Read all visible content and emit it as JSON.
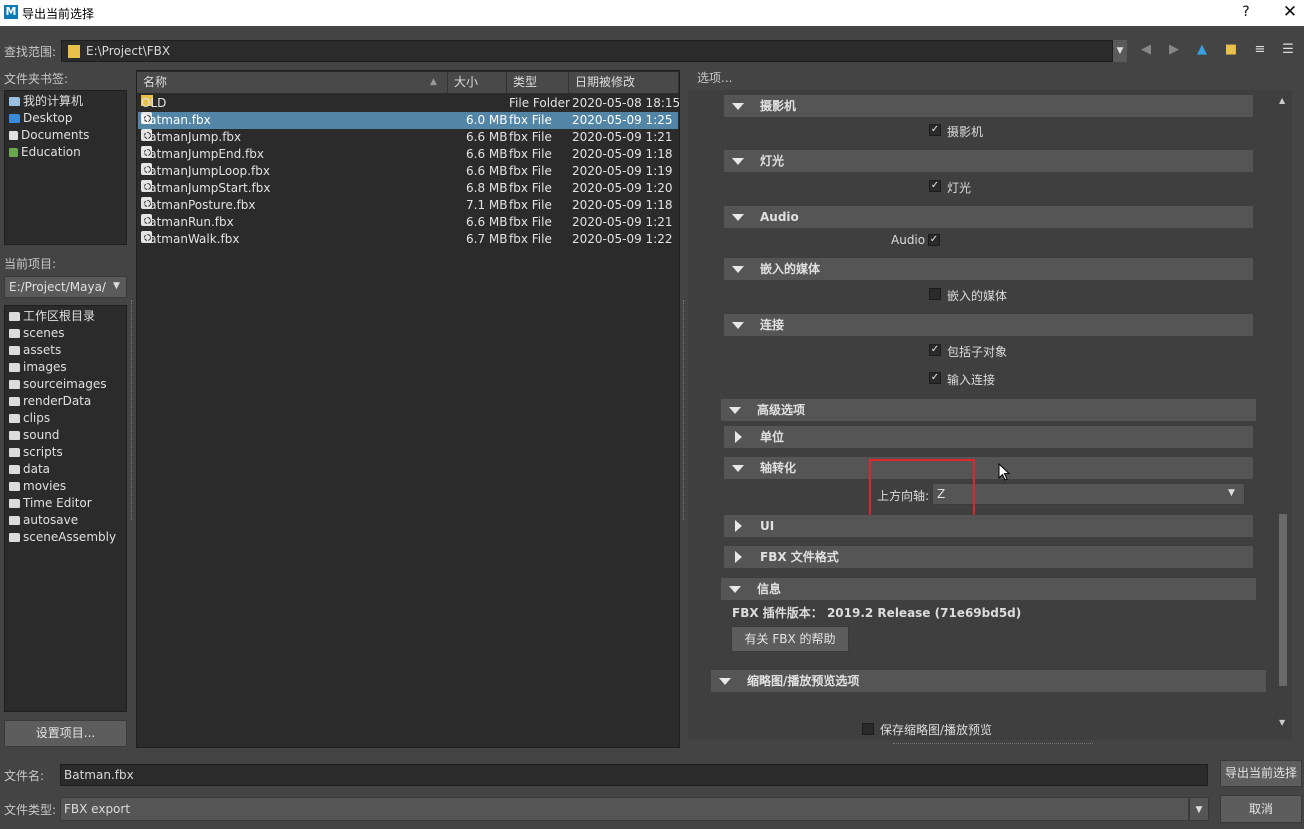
{
  "window": {
    "title": "导出当前选择",
    "help": "?",
    "close": "✕",
    "logo": "M"
  },
  "look_in": {
    "label": "查找范围:",
    "path": "E:\\Project\\FBX"
  },
  "options_title": "选项...",
  "bookmarks": {
    "label": "文件夹书签:",
    "items": [
      {
        "label": "我的计算机"
      },
      {
        "label": "Desktop"
      },
      {
        "label": "Documents"
      },
      {
        "label": "Education"
      }
    ]
  },
  "project": {
    "label": "当前项目:",
    "value": "E:/Project/Maya/",
    "items": [
      "工作区根目录",
      "scenes",
      "assets",
      "images",
      "sourceimages",
      "renderData",
      "clips",
      "sound",
      "scripts",
      "data",
      "movies",
      "Time Editor",
      "autosave",
      "sceneAssembly"
    ],
    "set_button": "设置项目..."
  },
  "file_list": {
    "columns": {
      "name": "名称",
      "size": "大小",
      "type": "类型",
      "date": "日期被修改"
    },
    "rows": [
      {
        "name": "OLD",
        "size": "",
        "type": "File Folder",
        "date": "2020-05-08 18:15",
        "folder": true
      },
      {
        "name": "Batman.fbx",
        "size": "6.0 MB",
        "type": "fbx File",
        "date": "2020-05-09 1:25",
        "selected": true
      },
      {
        "name": "BatmanJump.fbx",
        "size": "6.6 MB",
        "type": "fbx File",
        "date": "2020-05-09 1:21"
      },
      {
        "name": "BatmanJumpEnd.fbx",
        "size": "6.6 MB",
        "type": "fbx File",
        "date": "2020-05-09 1:18"
      },
      {
        "name": "BatmanJumpLoop.fbx",
        "size": "6.6 MB",
        "type": "fbx File",
        "date": "2020-05-09 1:19"
      },
      {
        "name": "BatmanJumpStart.fbx",
        "size": "6.8 MB",
        "type": "fbx File",
        "date": "2020-05-09 1:20"
      },
      {
        "name": "BatmanPosture.fbx",
        "size": "7.1 MB",
        "type": "fbx File",
        "date": "2020-05-09 1:18"
      },
      {
        "name": "BatmanRun.fbx",
        "size": "6.6 MB",
        "type": "fbx File",
        "date": "2020-05-09 1:21"
      },
      {
        "name": "BatmanWalk.fbx",
        "size": "6.7 MB",
        "type": "fbx File",
        "date": "2020-05-09 1:22"
      }
    ]
  },
  "options": {
    "camera": {
      "title": "摄影机",
      "check_label": "摄影机"
    },
    "lights": {
      "title": "灯光",
      "check_label": "灯光"
    },
    "audio": {
      "title": "Audio",
      "check_label": "Audio"
    },
    "media": {
      "title": "嵌入的媒体",
      "check_label": "嵌入的媒体"
    },
    "connections": {
      "title": "连接",
      "check1": "包括子对象",
      "check2": "输入连接"
    },
    "advanced": {
      "title": "高级选项"
    },
    "units": {
      "title": "单位"
    },
    "axis": {
      "title": "轴转化",
      "up_axis_label": "上方向轴:",
      "up_axis_value": "Z"
    },
    "ui": {
      "title": "UI"
    },
    "fbx_format": {
      "title": "FBX 文件格式"
    },
    "info": {
      "title": "信息",
      "version": "FBX 插件版本： 2019.2 Release (71e69bd5d)",
      "help_button": "有关 FBX 的帮助"
    },
    "thumbnail": {
      "title": "缩略图/播放预览选项",
      "check_label": "保存缩略图/播放预览"
    }
  },
  "bottom": {
    "filename_label": "文件名:",
    "filename_value": "Batman.fbx",
    "filetype_label": "文件类型:",
    "filetype_value": "FBX export",
    "export_button": "导出当前选择",
    "cancel_button": "取消"
  },
  "colors": {
    "selection": "#5285a6",
    "highlight_box": "#e0262a"
  }
}
